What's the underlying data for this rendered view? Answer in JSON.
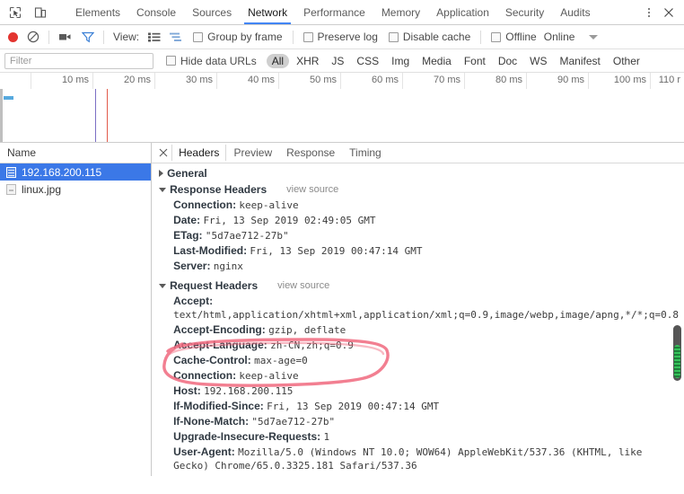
{
  "devtools": {
    "icons": {
      "inspect": "inspect-cursor-icon",
      "device": "device-toolbar-icon"
    },
    "tabs": [
      {
        "label": "Elements",
        "active": false
      },
      {
        "label": "Console",
        "active": false
      },
      {
        "label": "Sources",
        "active": false
      },
      {
        "label": "Network",
        "active": true
      },
      {
        "label": "Performance",
        "active": false
      },
      {
        "label": "Memory",
        "active": false
      },
      {
        "label": "Application",
        "active": false
      },
      {
        "label": "Security",
        "active": false
      },
      {
        "label": "Audits",
        "active": false
      }
    ],
    "more_menu": "more-options-icon",
    "close": "✕"
  },
  "toolbar": {
    "record_tooltip": "Record",
    "clear_glyph": "⃠",
    "camera_glyph": "■",
    "filter_glyph": "▽",
    "view_label": "View:",
    "group_by_frame": "Group by frame",
    "preserve_log": "Preserve log",
    "disable_cache": "Disable cache",
    "offline": "Offline",
    "online": "Online"
  },
  "filterbar": {
    "placeholder": "Filter",
    "value": "",
    "hide_data_urls": "Hide data URLs",
    "types": [
      {
        "label": "All",
        "selected": true
      },
      {
        "label": "XHR",
        "selected": false
      },
      {
        "label": "JS",
        "selected": false
      },
      {
        "label": "CSS",
        "selected": false
      },
      {
        "label": "Img",
        "selected": false
      },
      {
        "label": "Media",
        "selected": false
      },
      {
        "label": "Font",
        "selected": false
      },
      {
        "label": "Doc",
        "selected": false
      },
      {
        "label": "WS",
        "selected": false
      },
      {
        "label": "Manifest",
        "selected": false
      },
      {
        "label": "Other",
        "selected": false
      }
    ]
  },
  "overview": {
    "ticks": [
      "10 ms",
      "20 ms",
      "30 ms",
      "40 ms",
      "50 ms",
      "60 ms",
      "70 ms",
      "80 ms",
      "90 ms",
      "100 ms",
      "110 r"
    ],
    "tick_x": [
      103,
      172,
      241,
      310,
      379,
      448,
      517,
      586,
      655,
      724,
      762
    ],
    "dom_content_loaded_color": "#7b6fc4",
    "load_event_color": "#e25b4a",
    "request_bar_color": "#57a9de"
  },
  "requests": {
    "column_header": "Name",
    "rows": [
      {
        "name": "192.168.200.115",
        "icon": "document-file-icon",
        "selected": true
      },
      {
        "name": "linux.jpg",
        "icon": "image-file-icon",
        "selected": false
      }
    ]
  },
  "details": {
    "tabs": [
      {
        "label": "Headers",
        "active": true
      },
      {
        "label": "Preview",
        "active": false
      },
      {
        "label": "Response",
        "active": false
      },
      {
        "label": "Timing",
        "active": false
      }
    ],
    "sections": [
      {
        "title": "General",
        "expanded": false,
        "view_source": null,
        "headers": []
      },
      {
        "title": "Response Headers",
        "expanded": true,
        "view_source": "view source",
        "headers": [
          {
            "name": "Connection:",
            "value": "keep-alive"
          },
          {
            "name": "Date:",
            "value": "Fri, 13 Sep 2019 02:49:05 GMT"
          },
          {
            "name": "ETag:",
            "value": "\"5d7ae712-27b\""
          },
          {
            "name": "Last-Modified:",
            "value": "Fri, 13 Sep 2019 00:47:14 GMT"
          },
          {
            "name": "Server:",
            "value": "nginx"
          }
        ]
      },
      {
        "title": "Request Headers",
        "expanded": true,
        "view_source": "view source",
        "headers": [
          {
            "name": "Accept:",
            "value": "text/html,application/xhtml+xml,application/xml;q=0.9,image/webp,image/apng,*/*;q=0.8"
          },
          {
            "name": "Accept-Encoding:",
            "value": "gzip, deflate"
          },
          {
            "name": "Accept-Language:",
            "value": "zh-CN,zh;q=0.9"
          },
          {
            "name": "Cache-Control:",
            "value": "max-age=0"
          },
          {
            "name": "Connection:",
            "value": "keep-alive"
          },
          {
            "name": "Host:",
            "value": "192.168.200.115"
          },
          {
            "name": "If-Modified-Since:",
            "value": "Fri, 13 Sep 2019 00:47:14 GMT"
          },
          {
            "name": "If-None-Match:",
            "value": "\"5d7ae712-27b\""
          },
          {
            "name": "Upgrade-Insecure-Requests:",
            "value": "1"
          },
          {
            "name": "User-Agent:",
            "value": "Mozilla/5.0 (Windows NT 10.0; WOW64) AppleWebKit/537.36 (KHTML, like Gecko) Chrome/65.0.3325.181 Safari/537.36"
          }
        ]
      }
    ]
  },
  "annotation": {
    "type": "hand-drawn-ellipse",
    "color": "#f0697e",
    "targets": [
      "Accept-Encoding",
      "Accept-Language"
    ]
  },
  "colors": {
    "accent": "#4285f4",
    "selection": "#3b78e7",
    "record": "#e3342f",
    "annotation": "#f0697e",
    "scrollbar": "#555555",
    "scrollbar_stripe": "#35c25a"
  }
}
